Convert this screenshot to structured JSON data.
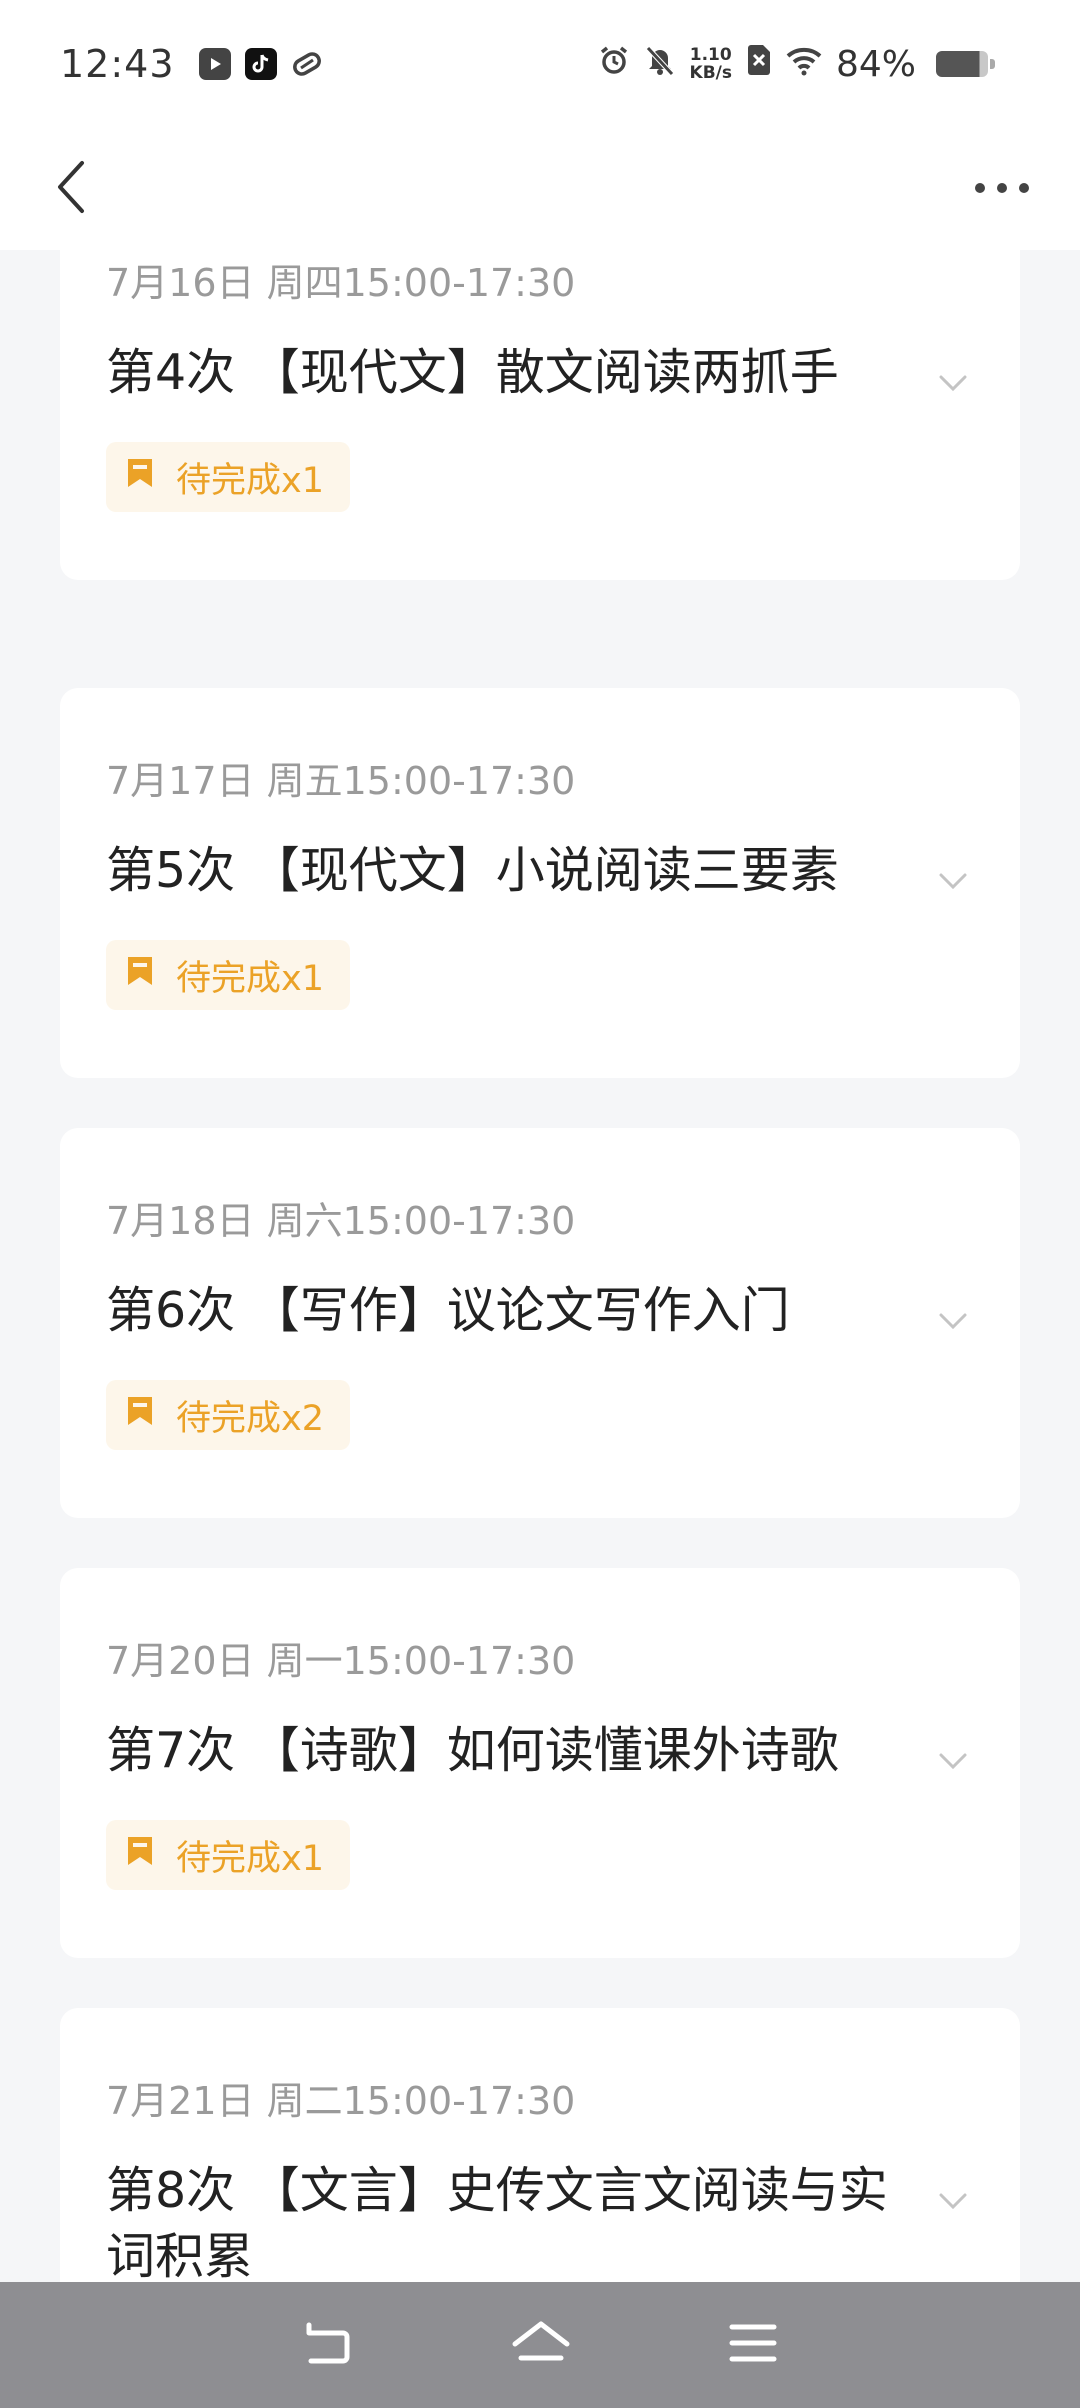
{
  "status_bar": {
    "time": "12:43",
    "net_speed_value": "1.10",
    "net_speed_unit": "KB/s",
    "battery_percent": "84%",
    "battery_level": 0.84,
    "icons": [
      "video-app-icon",
      "tiktok-icon",
      "link-app-icon",
      "alarm-icon",
      "mute-icon",
      "sim-disabled-icon",
      "wifi-icon",
      "battery-icon"
    ]
  },
  "nav": {
    "back_icon": "chevron-left-icon",
    "more_icon": "more-horizontal-icon"
  },
  "lessons": [
    {
      "date": "7月16日 周四15:00-17:30",
      "title": "第4次 【现代文】散文阅读两抓手",
      "badge": "待完成x1"
    },
    {
      "date": "7月17日 周五15:00-17:30",
      "title": "第5次 【现代文】小说阅读三要素",
      "badge": "待完成x1"
    },
    {
      "date": "7月18日 周六15:00-17:30",
      "title": "第6次 【写作】议论文写作入门",
      "badge": "待完成x2"
    },
    {
      "date": "7月20日 周一15:00-17:30",
      "title": "第7次 【诗歌】如何读懂课外诗歌",
      "badge": "待完成x1"
    },
    {
      "date": "7月21日 周二15:00-17:30",
      "title": "第8次 【文言】史传文言文阅读与实词积累",
      "badge": ""
    }
  ],
  "colors": {
    "accent": "#eba227",
    "badge_bg": "#fdf6ea",
    "page_bg": "#f5f6f8",
    "title_text": "#222222",
    "date_text": "#9a9a9a",
    "system_nav_bg": "#8e8e92"
  },
  "system_nav": {
    "icons": [
      "back-nav-icon",
      "home-nav-icon",
      "menu-nav-icon"
    ]
  }
}
